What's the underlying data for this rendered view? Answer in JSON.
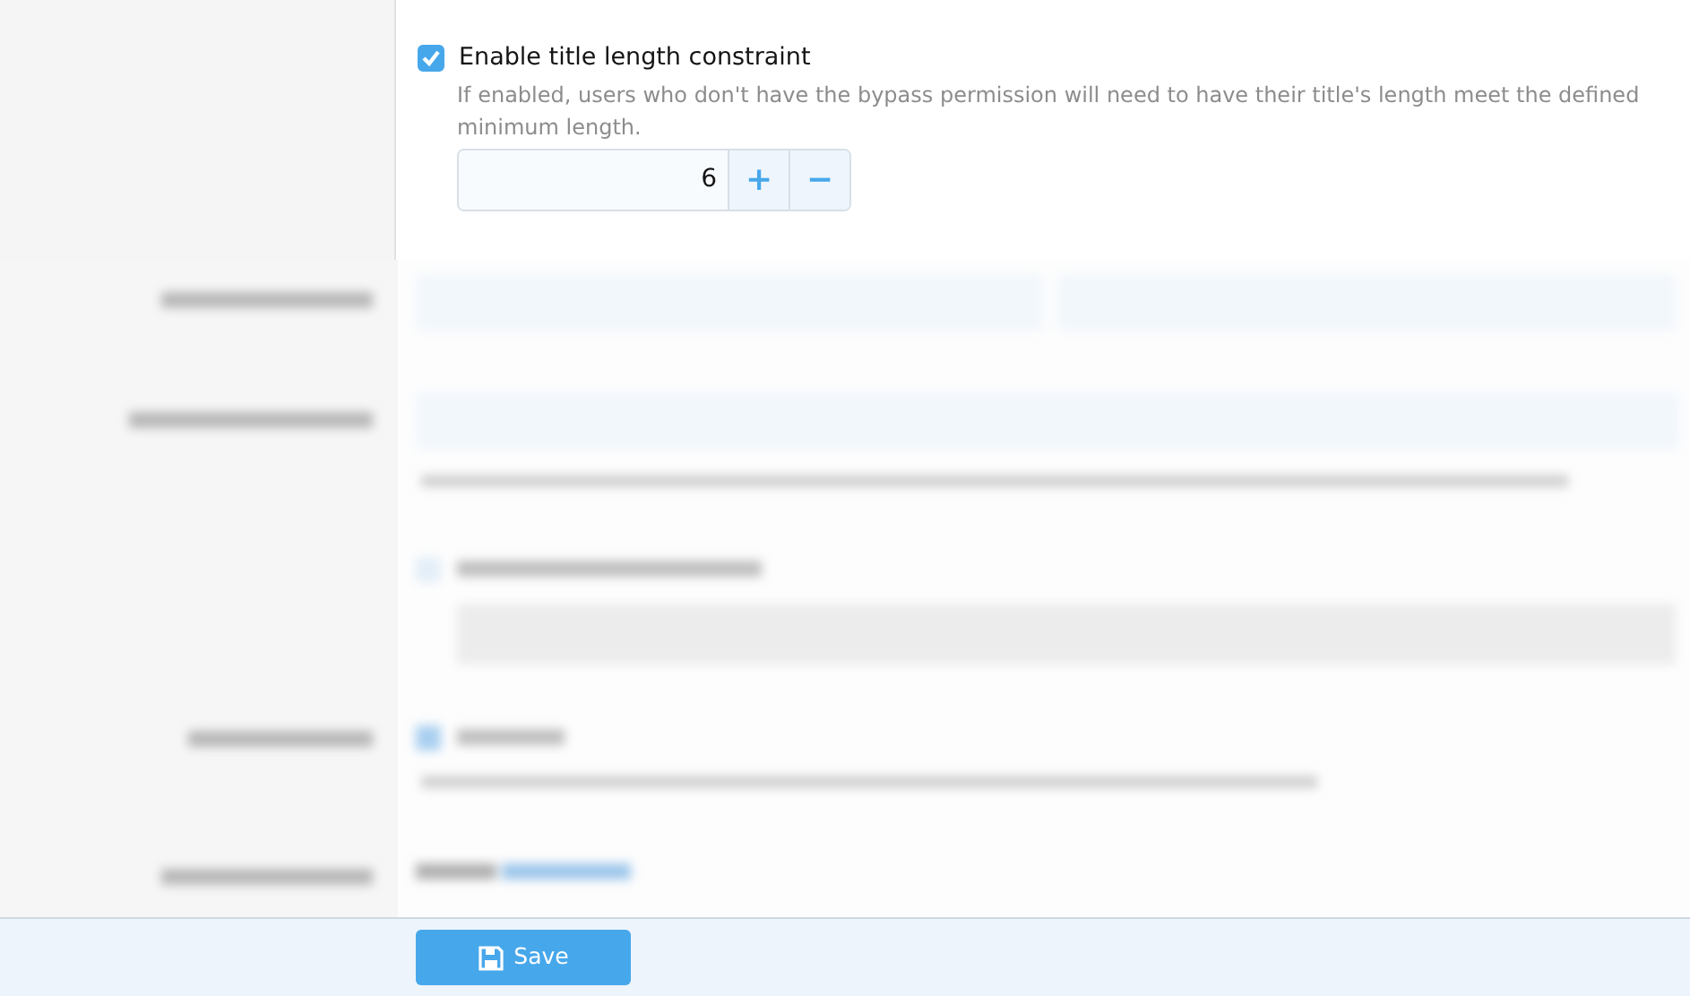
{
  "title_length": {
    "label": "Enable title length constraint",
    "checked": true,
    "hint": "If enabled, users who don't have the bypass permission will need to have their title's length meet the defined minimum length.",
    "value": "6",
    "increment": "+",
    "decrement": "−"
  },
  "footer": {
    "save_button": "Save"
  }
}
